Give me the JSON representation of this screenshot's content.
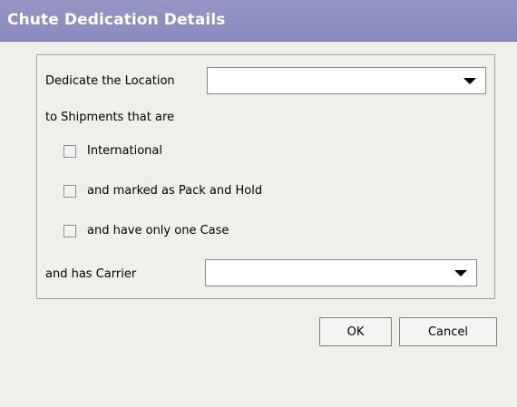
{
  "dialog": {
    "title": "Chute Dedication Details"
  },
  "form": {
    "dedicate_label": "Dedicate the Location",
    "dedicate_value": "",
    "shipments_label": "to Shipments that are",
    "checkboxes": [
      {
        "label": "International",
        "checked": false
      },
      {
        "label": "and marked as Pack and Hold",
        "checked": false
      },
      {
        "label": "and have only one Case",
        "checked": false
      }
    ],
    "carrier_label": "and has Carrier",
    "carrier_value": ""
  },
  "buttons": {
    "ok": "OK",
    "cancel": "Cancel"
  }
}
